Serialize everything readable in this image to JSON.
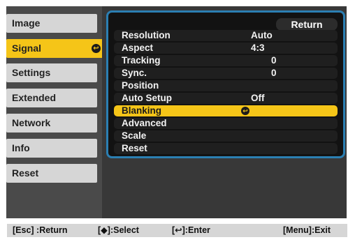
{
  "sidebar": {
    "items": [
      {
        "label": "Image"
      },
      {
        "label": "Signal"
      },
      {
        "label": "Settings"
      },
      {
        "label": "Extended"
      },
      {
        "label": "Network"
      },
      {
        "label": "Info"
      },
      {
        "label": "Reset"
      }
    ],
    "enter_glyph": "↩"
  },
  "submenu": {
    "return_label": "Return",
    "rows": [
      {
        "label": "Resolution",
        "value": "Auto"
      },
      {
        "label": "Aspect",
        "value": "4:3"
      },
      {
        "label": "Tracking",
        "value": "0"
      },
      {
        "label": "Sync.",
        "value": "0"
      },
      {
        "label": "Position",
        "value": ""
      },
      {
        "label": "Auto Setup",
        "value": "Off"
      },
      {
        "label": "Blanking",
        "value": ""
      },
      {
        "label": "Advanced",
        "value": ""
      },
      {
        "label": "Scale",
        "value": ""
      },
      {
        "label": "Reset",
        "value": ""
      }
    ]
  },
  "footer": {
    "esc": "[Esc] :Return",
    "select": "[◆]:Select",
    "enter": "[↩]:Enter",
    "menu": "[Menu]:Exit"
  },
  "colors": {
    "highlight": "#f5c518",
    "border_accent": "#2b7fb3",
    "background": "#4a4a4a"
  }
}
